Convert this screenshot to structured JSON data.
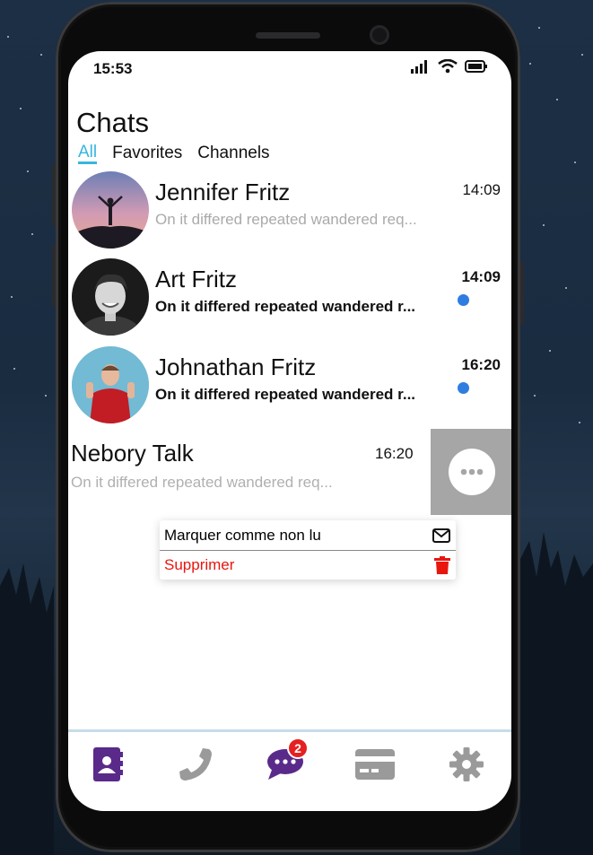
{
  "status_bar": {
    "time": "15:53"
  },
  "header": {
    "title": "Chats"
  },
  "tabs": [
    {
      "label": "All",
      "active": true
    },
    {
      "label": "Favorites",
      "active": false
    },
    {
      "label": "Channels",
      "active": false
    }
  ],
  "chats": [
    {
      "name": "Jennifer Fritz",
      "message": "On it differed repeated wandered req...",
      "time": "14:09",
      "unread": false
    },
    {
      "name": "Art Fritz",
      "message": "On it differed repeated wandered r...",
      "time": "14:09",
      "unread": true
    },
    {
      "name": "Johnathan Fritz",
      "message": "On it differed repeated wandered r...",
      "time": "16:20",
      "unread": true
    },
    {
      "name": "Nebory Talk",
      "message": "On it differed repeated wandered req...",
      "time": "16:20",
      "unread": false,
      "swiped": true
    }
  ],
  "context_menu": {
    "mark_unread": "Marquer comme non lu",
    "delete": "Supprimer"
  },
  "bottom_nav": {
    "items": [
      "contacts-icon",
      "phone-icon",
      "chat-icon",
      "card-icon",
      "gear-icon"
    ],
    "active": "contacts-icon",
    "chat_badge": "2"
  },
  "colors": {
    "accent": "#36b6de",
    "unread_dot": "#2f7de0",
    "nav_active": "#5a2a8a",
    "nav_inactive": "#9a9a9a",
    "danger": "#e8160f",
    "badge": "#e52020"
  }
}
